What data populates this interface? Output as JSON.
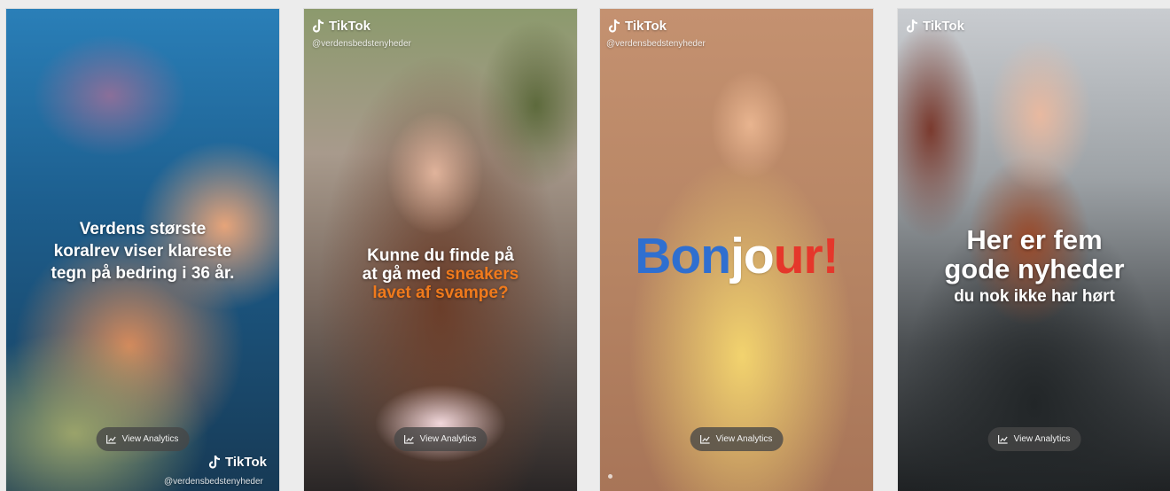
{
  "brand_name": "TikTok",
  "handle": "@verdensbedstenyheder",
  "analytics_label": "View Analytics",
  "cards": [
    {
      "caption_lines": [
        "Verdens største",
        "koralrev viser klareste",
        "tegn på bedring i 36 år."
      ]
    },
    {
      "caption_line1": "Kunne du finde på",
      "caption_line2_pre": "at gå med ",
      "caption_line2_highlight": "sneakers",
      "caption_line3": "lavet af svampe?",
      "highlight_color": "#f07a1c"
    },
    {
      "title_parts": [
        "Bon",
        "jo",
        "ur!"
      ],
      "title_colors": [
        "#2f6fd0",
        "#ffffff",
        "#e5372b"
      ]
    },
    {
      "caption_big_lines": [
        "Her er fem",
        "gode nyheder"
      ],
      "caption_small": "du nok ikke har hørt"
    }
  ],
  "icons": {
    "brand": "tiktok-logo-icon",
    "analytics": "line-chart-icon"
  }
}
